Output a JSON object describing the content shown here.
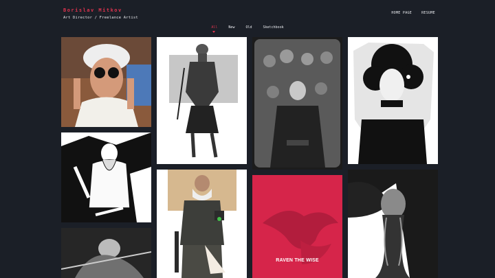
{
  "brand": {
    "name": "Borislav Mitkov",
    "subtitle": "Art Director / Freelance Artist"
  },
  "nav": {
    "home": "HOME PAGE",
    "resume": "RESUME"
  },
  "filters": [
    "All",
    "New",
    "Old",
    "Sketchbook"
  ],
  "active_filter": "All",
  "gallery": {
    "items": [
      {
        "subject": "scientist with goggles"
      },
      {
        "subject": "turbaned warrior sketch"
      },
      {
        "subject": "captain in crowd"
      },
      {
        "subject": "woman portrait ink"
      },
      {
        "subject": "bearded miner ink"
      },
      {
        "subject": "armored old soldier"
      },
      {
        "title": "RAVEN THE WISE"
      },
      {
        "subject": "tentacled creature"
      },
      {
        "subject": "dark warrior sketch"
      }
    ]
  },
  "colors": {
    "background": "#1b1f27",
    "accent": "#e0334f",
    "raven_card": "#d6254a"
  }
}
